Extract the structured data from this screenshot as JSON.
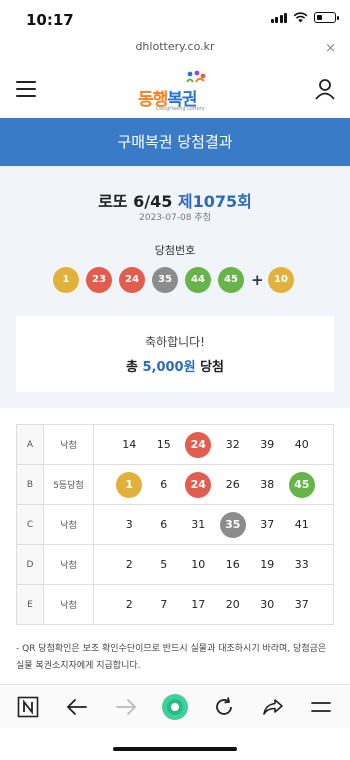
{
  "status": {
    "time": "10:17"
  },
  "browser": {
    "url": "dhlottery.co.kr",
    "close_icon": "×"
  },
  "header": {
    "logo_text_1": "동행",
    "logo_text_2": "복권",
    "logo_sub": "DongHaeng Lottery",
    "menu_icon": "hamburger-icon",
    "user_icon": "user-icon"
  },
  "page_title": "구매복권 당첨결과",
  "result": {
    "game": "로또 6/45",
    "round": "제1075회",
    "draw_date": "2023-07-08 추첨",
    "win_numbers_label": "당첨번호",
    "numbers": [
      {
        "n": "1",
        "color": "#e2b13c"
      },
      {
        "n": "23",
        "color": "#e35d4f"
      },
      {
        "n": "24",
        "color": "#e35d4f"
      },
      {
        "n": "35",
        "color": "#8c8c8c"
      },
      {
        "n": "44",
        "color": "#67b44a"
      },
      {
        "n": "45",
        "color": "#67b44a"
      }
    ],
    "plus": "+",
    "bonus": {
      "n": "10",
      "color": "#e2b13c"
    }
  },
  "congrats": {
    "line1": "축하합니다!",
    "prefix": "총",
    "amount": "5,000원",
    "suffix": "당첨"
  },
  "tickets": [
    {
      "letter": "A",
      "result": "낙첨",
      "numbers": [
        {
          "n": "14"
        },
        {
          "n": "15"
        },
        {
          "n": "24",
          "hit": "#e35d4f"
        },
        {
          "n": "32"
        },
        {
          "n": "39"
        },
        {
          "n": "40"
        }
      ]
    },
    {
      "letter": "B",
      "result": "5등당첨",
      "numbers": [
        {
          "n": "1",
          "hit": "#e2b13c"
        },
        {
          "n": "6"
        },
        {
          "n": "24",
          "hit": "#e35d4f"
        },
        {
          "n": "26"
        },
        {
          "n": "38"
        },
        {
          "n": "45",
          "hit": "#67b44a"
        }
      ]
    },
    {
      "letter": "C",
      "result": "낙첨",
      "numbers": [
        {
          "n": "3"
        },
        {
          "n": "6"
        },
        {
          "n": "31"
        },
        {
          "n": "35",
          "hit": "#8c8c8c"
        },
        {
          "n": "37"
        },
        {
          "n": "41"
        }
      ]
    },
    {
      "letter": "D",
      "result": "낙첨",
      "numbers": [
        {
          "n": "2"
        },
        {
          "n": "5"
        },
        {
          "n": "10"
        },
        {
          "n": "16"
        },
        {
          "n": "19"
        },
        {
          "n": "33"
        }
      ]
    },
    {
      "letter": "E",
      "result": "낙첨",
      "numbers": [
        {
          "n": "2"
        },
        {
          "n": "7"
        },
        {
          "n": "17"
        },
        {
          "n": "20"
        },
        {
          "n": "30"
        },
        {
          "n": "37"
        }
      ]
    }
  ],
  "notice": "- QR 당첨확인은 보조 확인수단이므로 반드시 실물과 대조하시기 바라며, 당첨금은 실물 복권소지자에게 지급합니다.",
  "bottom_nav": [
    {
      "name": "naver-icon"
    },
    {
      "name": "back-icon"
    },
    {
      "name": "forward-icon"
    },
    {
      "name": "green-dot-icon"
    },
    {
      "name": "refresh-icon"
    },
    {
      "name": "share-icon"
    },
    {
      "name": "menu-icon"
    }
  ]
}
